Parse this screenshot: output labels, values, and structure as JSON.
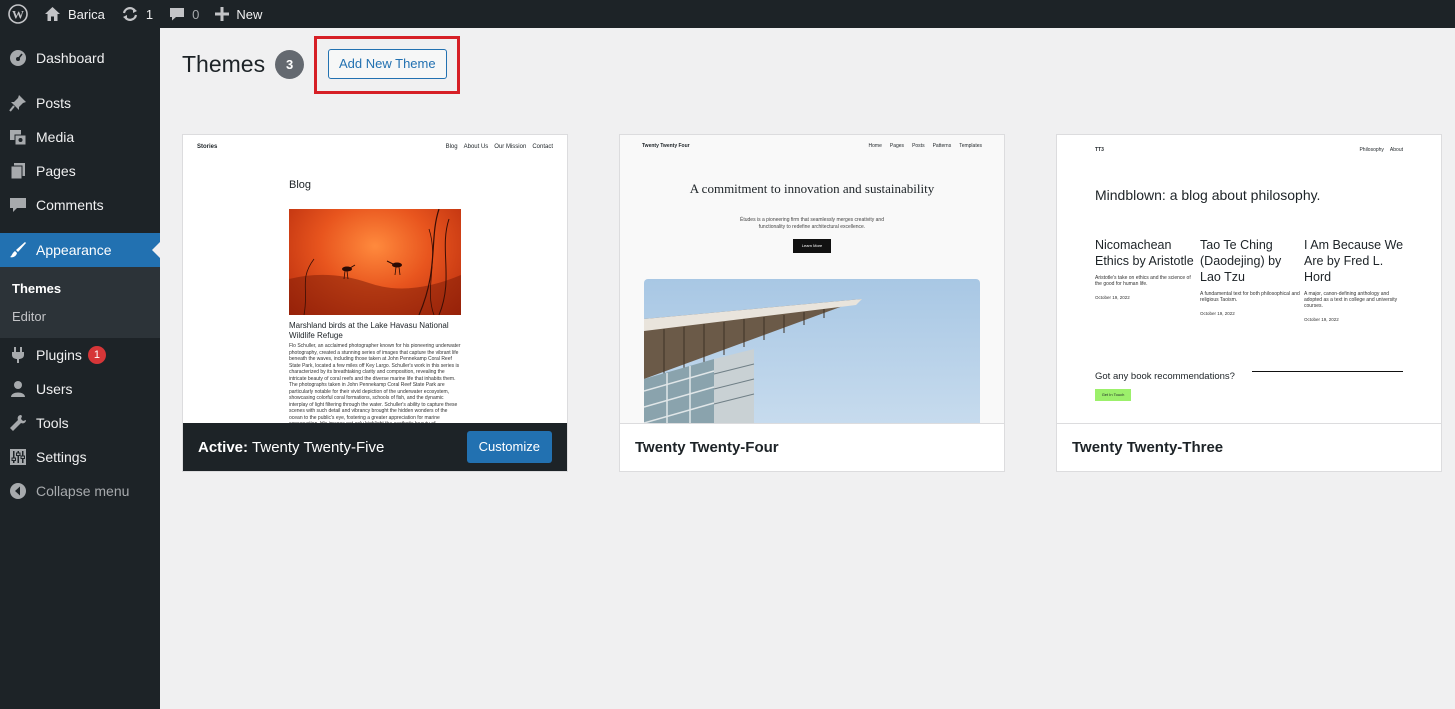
{
  "admin_bar": {
    "site_name": "Barica",
    "updates_count": "1",
    "comments_count": "0",
    "new_label": "New"
  },
  "sidebar": {
    "dashboard": "Dashboard",
    "posts": "Posts",
    "media": "Media",
    "pages": "Pages",
    "comments": "Comments",
    "appearance": "Appearance",
    "sub_themes": "Themes",
    "sub_editor": "Editor",
    "plugins": "Plugins",
    "plugins_badge": "1",
    "users": "Users",
    "tools": "Tools",
    "settings": "Settings",
    "collapse": "Collapse menu"
  },
  "page": {
    "title": "Themes",
    "count": "3",
    "add_new": "Add New Theme"
  },
  "themes": {
    "active": {
      "active_label": "Active:",
      "name": "Twenty Twenty-Five",
      "customize": "Customize",
      "preview": {
        "site_title": "Stories",
        "nav": [
          "Blog",
          "About Us",
          "Our Mission",
          "Contact"
        ],
        "heading": "Blog",
        "caption": "Marshland birds at the Lake Havasu National Wildlife Refuge",
        "body": "Flo Schuller, an acclaimed photographer known for his pioneering underwater photography, created a stunning series of images that capture the vibrant life beneath the waves, including those taken at John Pennekamp Coral Reef State Park, located a few miles off Key Largo. Schuller's work in this series is characterized by its breathtaking clarity and composition, revealing the intricate beauty of coral reefs and the diverse marine life that inhabits them. The photographs taken in John Pennekamp Coral Reef State Park are particularly notable for their vivid depiction of the underwater ecosystem, showcasing colorful coral formations, schools of fish, and the dynamic interplay of light filtering through the water. Schuller's ability to capture these scenes with such detail and vibrancy brought the hidden wonders of the ocean to the public's eye, fostering a greater appreciation for marine conservation. His images not only highlight the aesthetic beauty of underwater environments but"
      }
    },
    "second": {
      "name": "Twenty Twenty-Four",
      "preview": {
        "site_title": "Twenty Twenty Four",
        "nav": [
          "Home",
          "Pages",
          "Posts",
          "Patterns",
          "Templates"
        ],
        "heading": "A commitment to innovation and sustainability",
        "subtext": "Études is a pioneering firm that seamlessly merges creativity and functionality to redefine architectural excellence.",
        "button": "Learn More"
      }
    },
    "third": {
      "name": "Twenty Twenty-Three",
      "preview": {
        "site_title": "TT3",
        "nav": [
          "Philosophy",
          "About"
        ],
        "heading": "Mindblown: a blog about philosophy.",
        "posts": [
          {
            "title": "Nicomachean Ethics by Aristotle",
            "desc": "Aristotle's take on ethics and the science of the good for human life.",
            "date": "October 19, 2022"
          },
          {
            "title": "Tao Te Ching (Daodejing) by Lao Tzu",
            "desc": "A fundamental text for both philosophical and religious Taoism.",
            "date": "October 19, 2022"
          },
          {
            "title": "I Am Because We Are by Fred L. Hord",
            "desc": "A major, canon-defining anthology and adopted as a text in college and university courses.",
            "date": "October 19, 2022"
          }
        ],
        "question": "Got any book recommendations?",
        "button": "Get In Touch"
      }
    }
  },
  "colors": {
    "admin_dark": "#1d2327",
    "accent_blue": "#2271b1",
    "highlight_red": "#d61f26",
    "badge_red": "#d63638"
  }
}
